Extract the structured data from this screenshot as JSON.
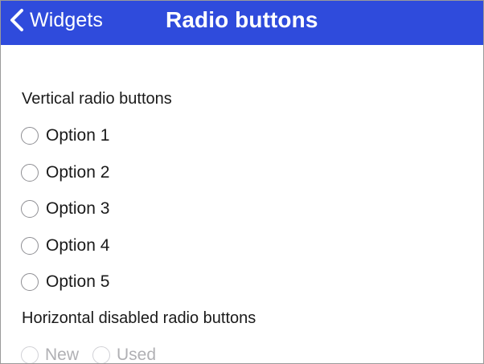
{
  "nav": {
    "back_label": "Widgets",
    "title": "Radio buttons",
    "back_icon": "chevron-left-icon",
    "bar_color": "#2f4bdc"
  },
  "vertical_section": {
    "label": "Vertical radio buttons",
    "options": [
      "Option 1",
      "Option 2",
      "Option 3",
      "Option 4",
      "Option 5"
    ]
  },
  "horizontal_section": {
    "label": "Horizontal disabled radio buttons",
    "options": [
      "New",
      "Used"
    ]
  }
}
